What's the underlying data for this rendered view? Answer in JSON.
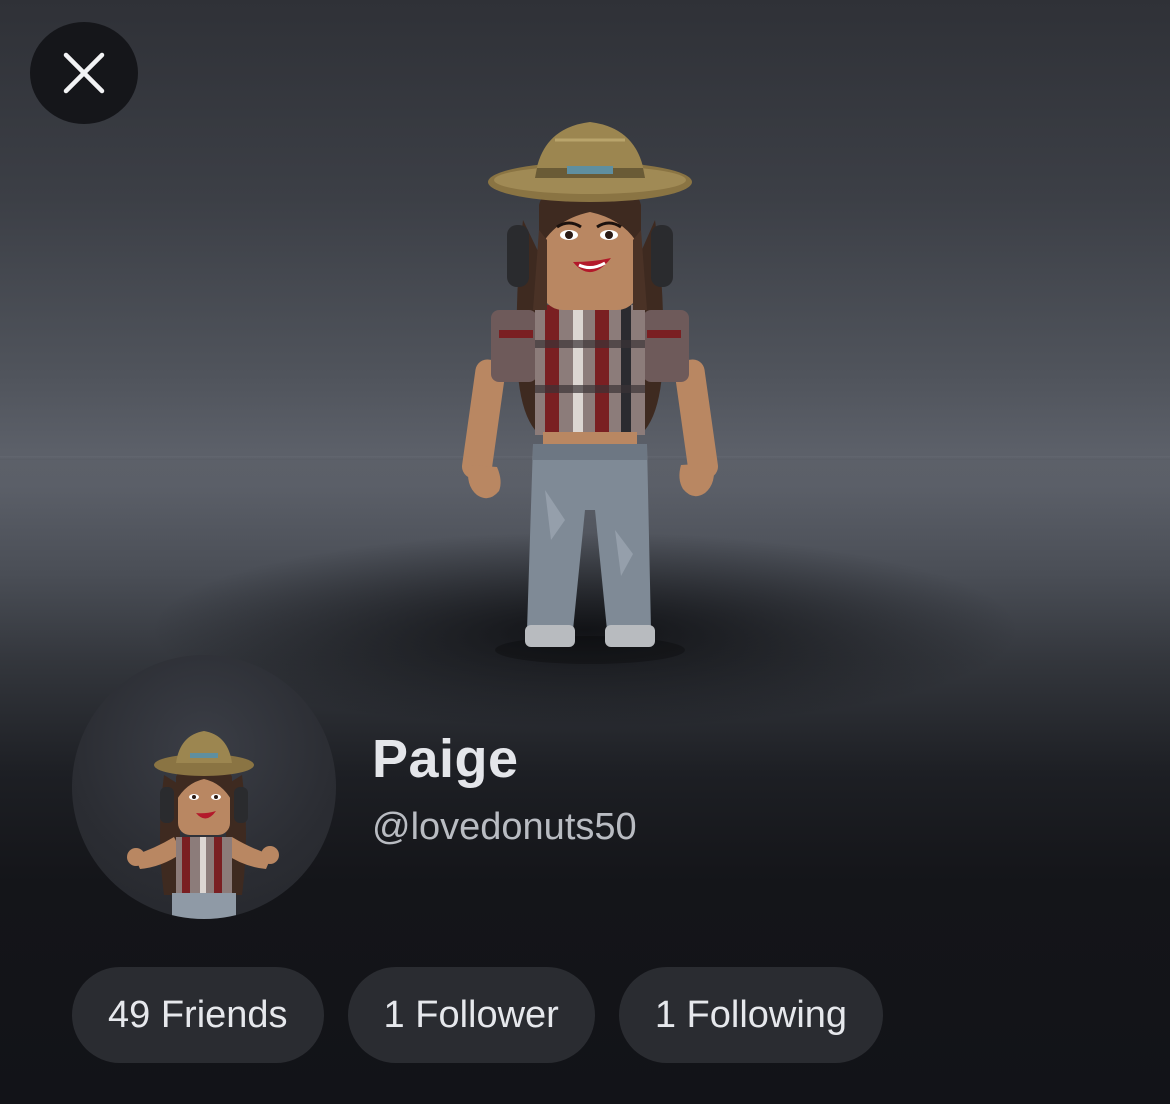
{
  "profile": {
    "display_name": "Paige",
    "username": "@lovedonuts50"
  },
  "stats": {
    "friends": "49 Friends",
    "followers": "1 Follower",
    "following": "1 Following"
  },
  "icons": {
    "close": "close-icon"
  },
  "colors": {
    "background_dark": "#121318",
    "pill_background": "#2a2c31",
    "close_button_background": "#15161a",
    "display_name_text": "#e4e6ea",
    "username_text": "#b9bcc2"
  }
}
